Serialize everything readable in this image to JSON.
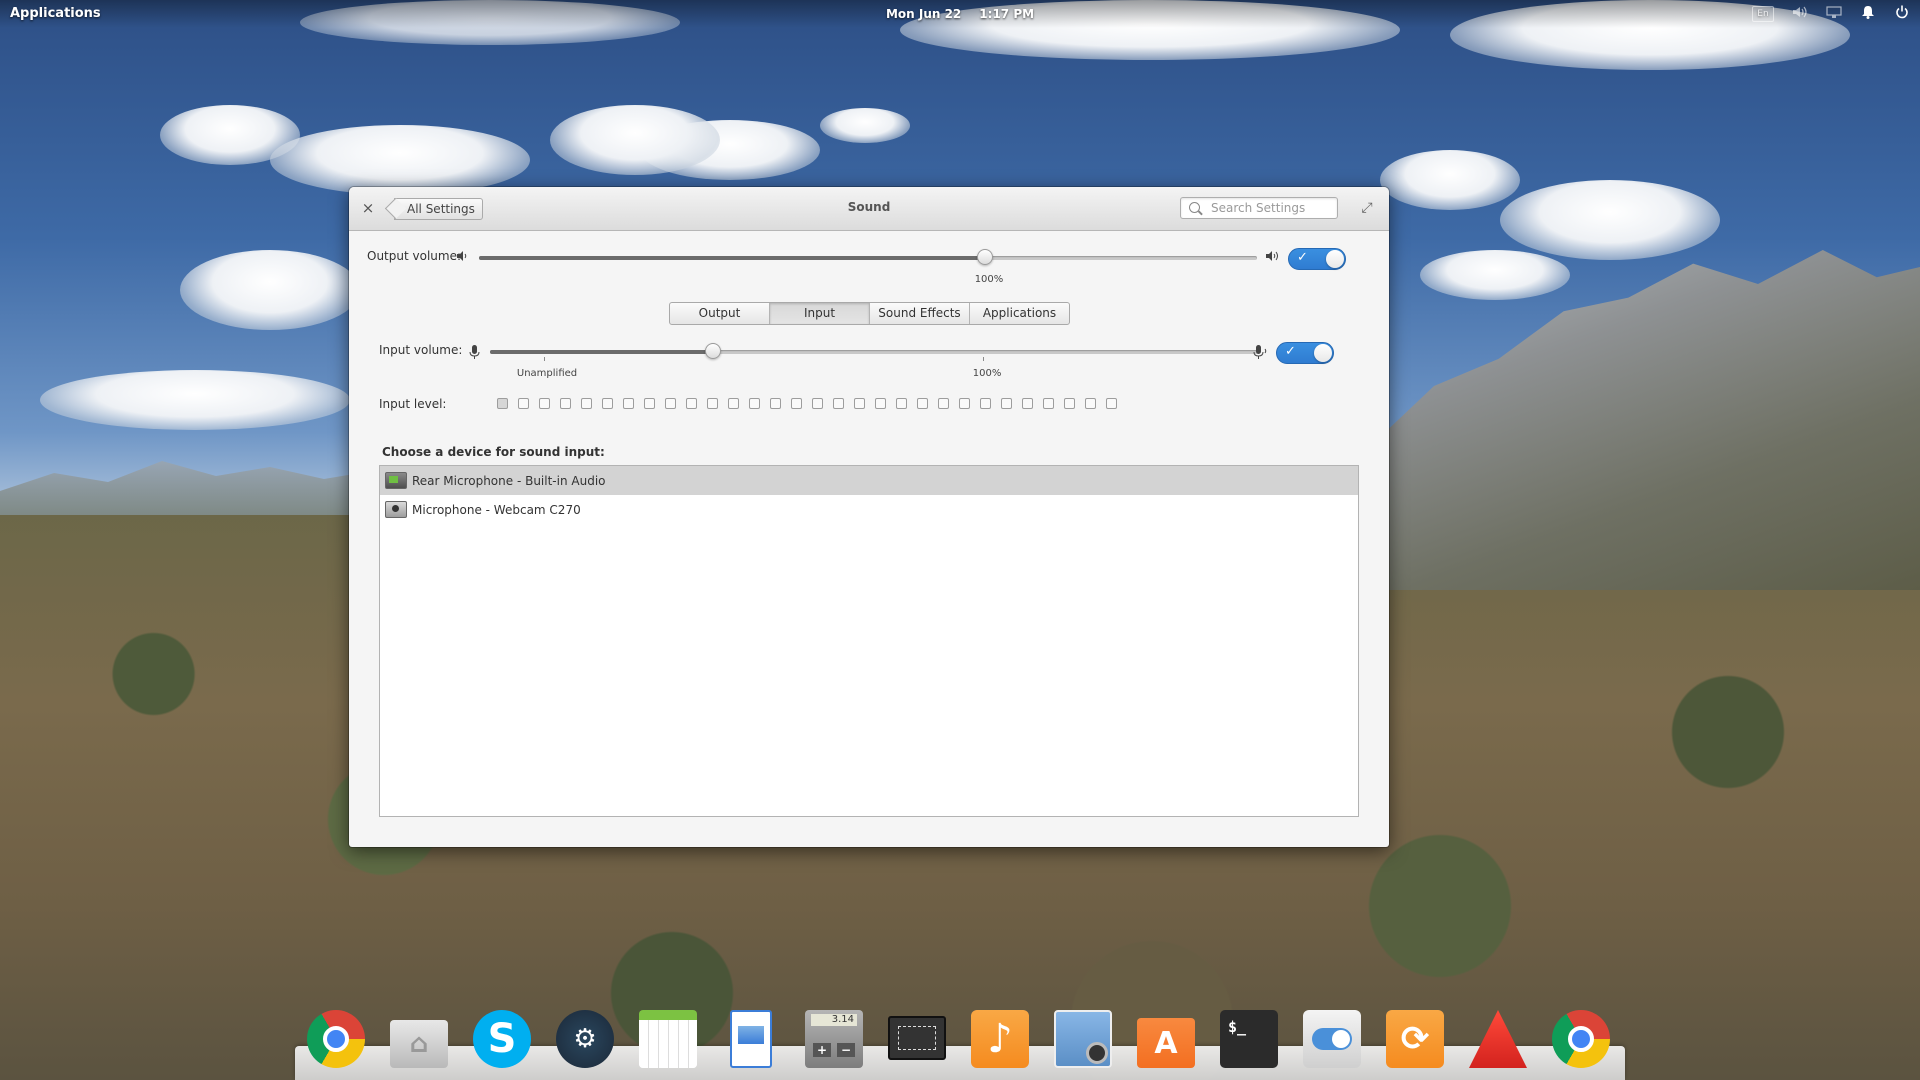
{
  "panel": {
    "applications_label": "Applications",
    "date": "Mon Jun 22",
    "time": "1:17 PM",
    "keyboard_indicator": "En",
    "indicators": [
      "keyboard-layout-icon",
      "volume-icon",
      "network-icon",
      "notifications-icon",
      "power-icon"
    ]
  },
  "window": {
    "title": "Sound",
    "back_label": "All Settings",
    "search_placeholder": "Search Settings",
    "close_symbol": "×",
    "maximize_symbol": "⤢"
  },
  "output": {
    "label": "Output volume:",
    "value_percent": 65,
    "mark_100_label": "100%",
    "enabled": true
  },
  "tabs": [
    {
      "label": "Output",
      "active": false
    },
    {
      "label": "Input",
      "active": true
    },
    {
      "label": "Sound Effects",
      "active": false
    },
    {
      "label": "Applications",
      "active": false
    }
  ],
  "input": {
    "label": "Input volume:",
    "value_percent": 29,
    "mark_unamplified_label": "Unamplified",
    "mark_100_label": "100%",
    "enabled": true,
    "level_label": "Input level:",
    "level_count": 30,
    "level_active": 0
  },
  "devices": {
    "title": "Choose a device for sound input:",
    "items": [
      {
        "label": "Rear Microphone - Built-in Audio",
        "icon": "sound-card-icon",
        "selected": true
      },
      {
        "label": "Microphone - Webcam C270",
        "icon": "webcam-icon",
        "selected": false
      }
    ]
  },
  "dock": {
    "items": [
      {
        "name": "chrome-icon",
        "color": "#4285f4"
      },
      {
        "name": "files-icon",
        "color": "#cfcfcf"
      },
      {
        "name": "skype-icon",
        "color": "#00aff0"
      },
      {
        "name": "steam-icon",
        "color": "#1b2838"
      },
      {
        "name": "calendar-icon",
        "color": "#7cc242"
      },
      {
        "name": "document-viewer-icon",
        "color": "#3b7dd8"
      },
      {
        "name": "calculator-icon",
        "color": "#9a9a9a"
      },
      {
        "name": "screenshot-icon",
        "color": "#333333"
      },
      {
        "name": "music-icon",
        "color": "#f58b1f"
      },
      {
        "name": "photos-icon",
        "color": "#88b6e6"
      },
      {
        "name": "app-center-icon",
        "color": "#f36f21"
      },
      {
        "name": "terminal-icon",
        "color": "#2b2b2b"
      },
      {
        "name": "system-settings-icon",
        "color": "#e3e3e3"
      },
      {
        "name": "software-updater-icon",
        "color": "#f58b1f"
      },
      {
        "name": "red-triangle-app-icon",
        "color": "#d3221e"
      },
      {
        "name": "chrome-icon",
        "color": "#4285f4"
      }
    ],
    "calculator_display": "3.14",
    "terminal_prompt": "$_"
  }
}
